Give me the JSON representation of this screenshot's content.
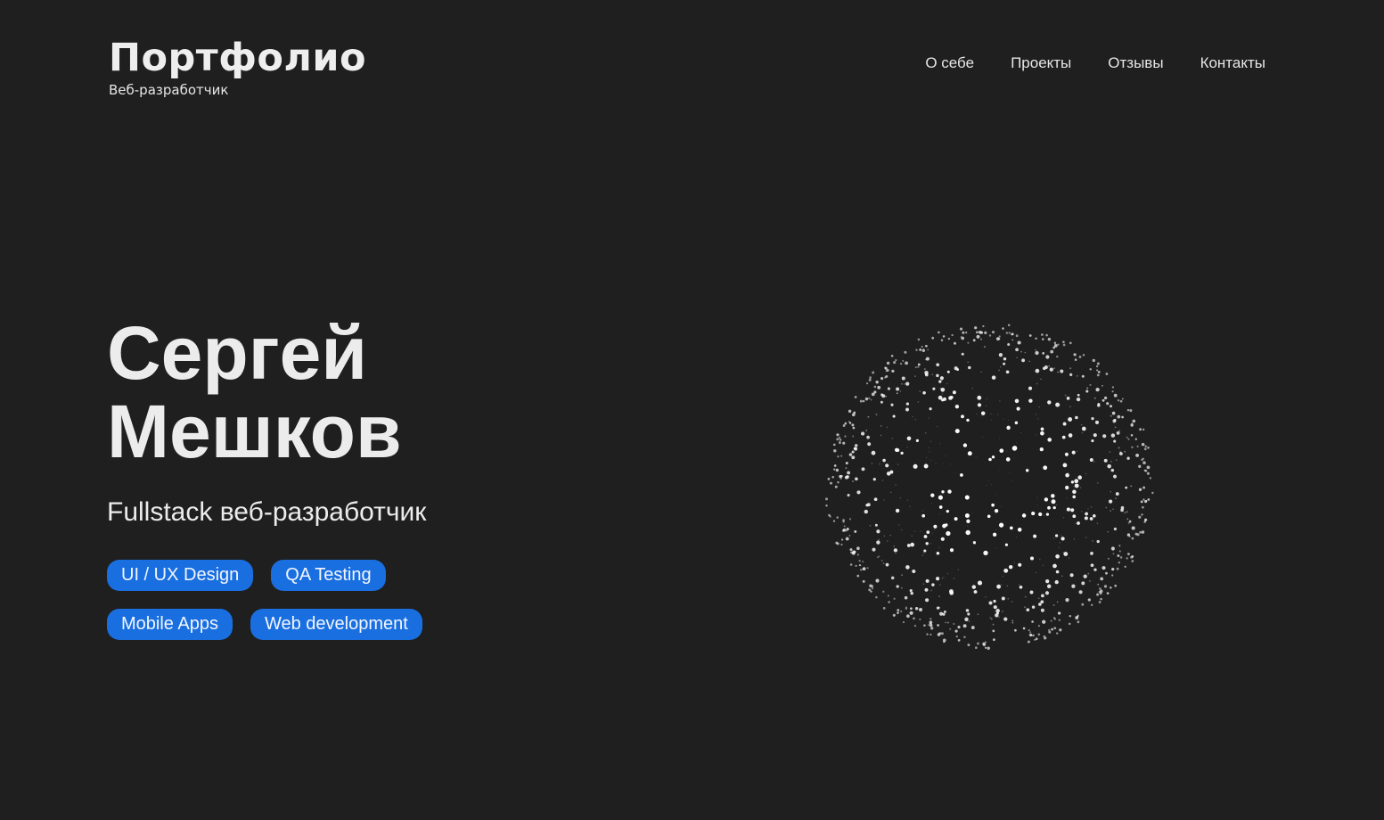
{
  "brand": {
    "title": "Портфолио",
    "subtitle": "Веб-разработчик"
  },
  "nav": {
    "items": [
      {
        "label": "О себе"
      },
      {
        "label": "Проекты"
      },
      {
        "label": "Отзывы"
      },
      {
        "label": "Контакты"
      }
    ]
  },
  "hero": {
    "first_name": "Сергей",
    "last_name": "Мешков",
    "role": "Fullstack веб-разработчик",
    "tags": [
      {
        "label": "UI / UX Design"
      },
      {
        "label": "QA Testing"
      },
      {
        "label": "Mobile Apps"
      },
      {
        "label": "Web development"
      }
    ]
  },
  "colors": {
    "background": "#1f1f1f",
    "text": "#ececec",
    "tag_background": "#1a6fe0",
    "particle": "#ffffff"
  },
  "sphere": {
    "icon": "particle-sphere"
  }
}
